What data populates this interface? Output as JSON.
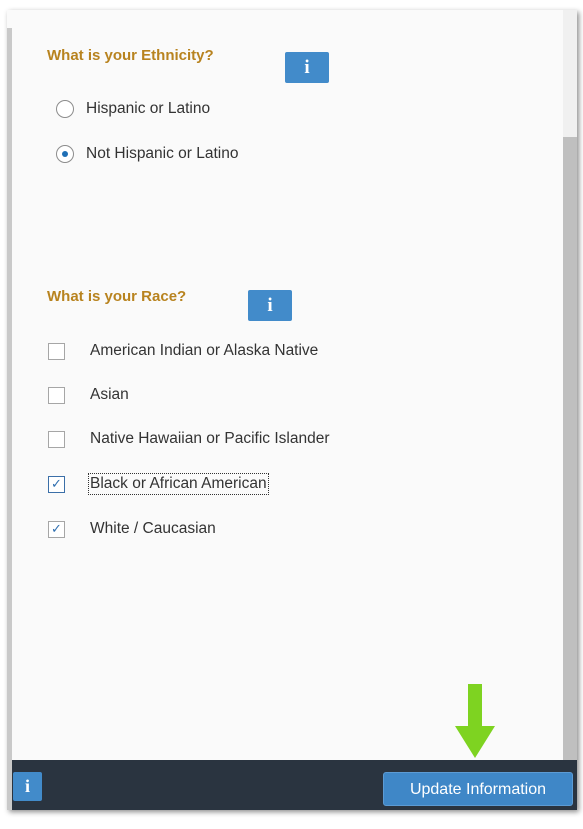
{
  "ethnicity": {
    "heading": "What is your Ethnicity?",
    "info_label": "i",
    "options": [
      {
        "label": "Hispanic or Latino",
        "selected": false
      },
      {
        "label": "Not Hispanic or Latino",
        "selected": true
      }
    ]
  },
  "race": {
    "heading": "What is your Race?",
    "info_label": "i",
    "options": [
      {
        "label": "American Indian or Alaska Native",
        "checked": false
      },
      {
        "label": "Asian",
        "checked": false
      },
      {
        "label": "Native Hawaiian or Pacific Islander",
        "checked": false
      },
      {
        "label": "Black or African American",
        "checked": true
      },
      {
        "label": "White / Caucasian",
        "checked": true
      }
    ]
  },
  "footer": {
    "info_label": "i",
    "update_label": "Update Information"
  },
  "colors": {
    "heading": "#b8831f",
    "info_button": "#428bca",
    "footer_bg": "#2a3440",
    "arrow": "#7ed321"
  },
  "icons": {
    "radio_checked": "radio-dot",
    "checkmark": "✓",
    "annotation_arrow": "down-arrow"
  }
}
